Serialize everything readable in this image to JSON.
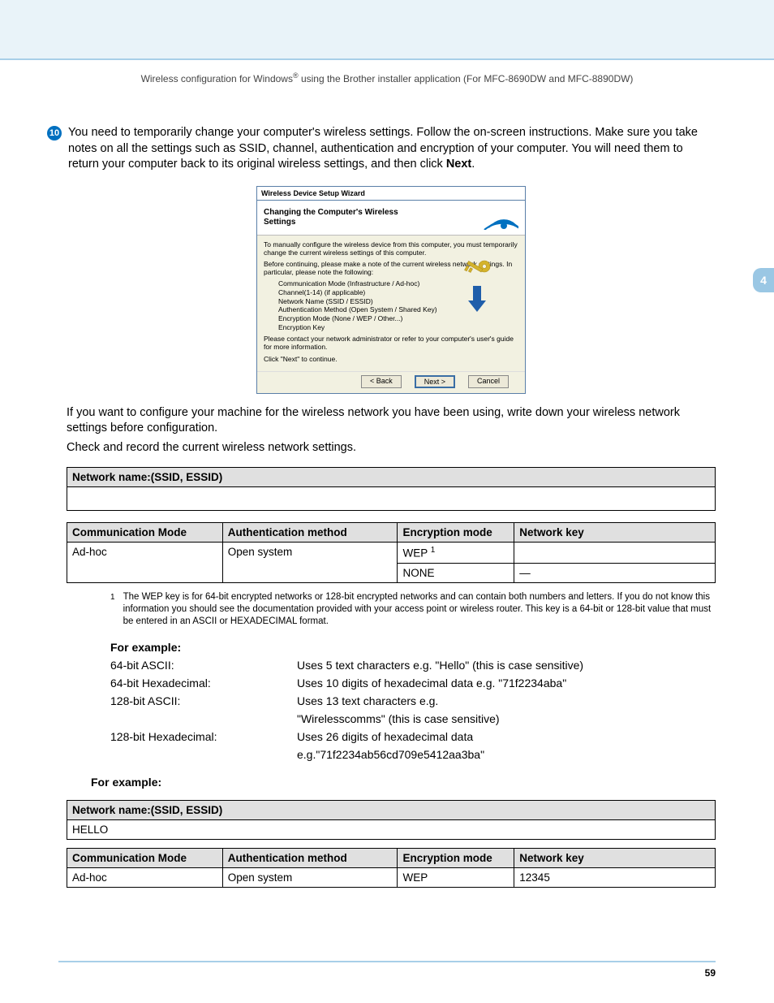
{
  "header": {
    "text_a": "Wireless configuration for Windows",
    "text_b": " using the Brother installer application (For MFC-8690DW and MFC-8890DW)"
  },
  "chapter_tab": "4",
  "step": {
    "number": "10",
    "p1": "You need to temporarily change your computer's wireless settings. Follow the on-screen instructions. Make sure you take notes on all the settings such as SSID, channel, authentication and encryption of your computer. You will need them to return your computer back to its original wireless settings, and then click ",
    "p1_bold": "Next",
    "p1_end": "."
  },
  "dialog": {
    "titlebar": "Wireless Device Setup Wizard",
    "hero_title": "Changing the Computer's Wireless Settings",
    "body_p1": "To manually configure the wireless device from this computer, you must temporarily change the current wireless settings of this computer.",
    "body_p2": "Before continuing, please make a note of the current wireless network settings. In particular, please note the following:",
    "list": [
      "Communication Mode (Infrastructure / Ad-hoc)",
      "Channel(1-14) (if applicable)",
      "Network Name (SSID / ESSID)",
      "Authentication Method (Open System / Shared Key)",
      "Encryption Mode (None / WEP / Other...)",
      "Encryption Key"
    ],
    "body_p3": "Please contact your network administrator or refer to your computer's user's guide for more information.",
    "body_p4": "Click \"Next\" to continue.",
    "buttons": {
      "back": "< Back",
      "next": "Next >",
      "cancel": "Cancel"
    }
  },
  "after_dialog": {
    "p1": "If you want to configure your machine for the wireless network you have been using, write down your wireless network settings before configuration.",
    "p2": "Check and record the current wireless network settings."
  },
  "table1": {
    "header": "Network name:(SSID, ESSID)"
  },
  "table2": {
    "headers": [
      "Communication Mode",
      "Authentication method",
      "Encryption mode",
      "Network key"
    ],
    "row1": {
      "cm": "Ad-hoc",
      "auth": "Open system",
      "enc": "WEP",
      "enc_sup": "1",
      "key": ""
    },
    "row2": {
      "enc": "NONE",
      "key": "—"
    }
  },
  "footnote": {
    "num": "1",
    "text": "The WEP key is for 64-bit encrypted networks or 128-bit encrypted networks and can contain both numbers and letters. If you do not know this information you should see the documentation provided with your access point or wireless router. This key is a 64-bit or 128-bit value that must be entered in an ASCII or HEXADECIMAL format."
  },
  "examples": {
    "title": "For example:",
    "rows": [
      {
        "label": "64-bit ASCII:",
        "value": "Uses 5 text characters e.g. \"Hello\" (this is case sensitive)"
      },
      {
        "label": "64-bit Hexadecimal:",
        "value": "Uses 10 digits of hexadecimal data e.g. \"71f2234aba\""
      },
      {
        "label": "128-bit ASCII:",
        "value": "Uses 13 text characters e.g."
      },
      {
        "label": "",
        "value": "\"Wirelesscomms\" (this is case sensitive)"
      },
      {
        "label": "128-bit Hexadecimal:",
        "value": "Uses 26 digits of hexadecimal data"
      },
      {
        "label": "",
        "value": "e.g.\"71f2234ab56cd709e5412aa3ba\""
      }
    ]
  },
  "for_example_2": "For example:",
  "table3": {
    "header": "Network name:(SSID, ESSID)",
    "value": "HELLO"
  },
  "table4": {
    "headers": [
      "Communication Mode",
      "Authentication method",
      "Encryption mode",
      "Network key"
    ],
    "row1": {
      "cm": "Ad-hoc",
      "auth": "Open system",
      "enc": "WEP",
      "key": "12345"
    }
  },
  "page_number": "59"
}
